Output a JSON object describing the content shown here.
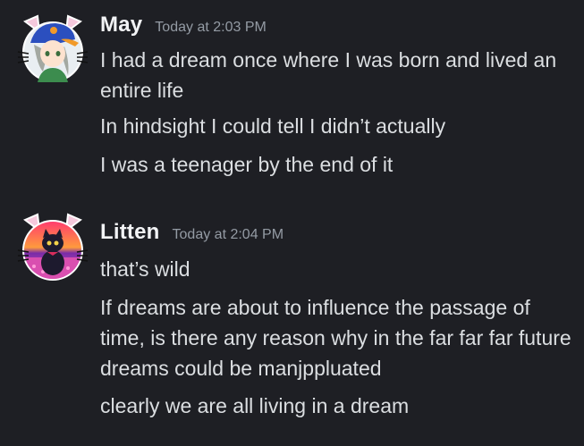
{
  "messages": [
    {
      "username": "May",
      "timestamp": "Today at 2:03 PM",
      "avatar_icon": "anime-character-with-cat-ears-avatar",
      "name_color": "#f2f3f5",
      "lines": [
        "I had a dream once where I was born and lived an entire life",
        "In hindsight I could tell I didn’t actually",
        "I was a teenager by the end of it"
      ]
    },
    {
      "username": "Litten",
      "timestamp": "Today at 2:04 PM",
      "avatar_icon": "black-cat-sunset-avatar",
      "name_color": "#f2f3f5",
      "lines": [
        "that’s wild",
        "If dreams are about to influence the passage of time, is there any reason why in the far far far future dreams could be manjppluated",
        "clearly we are all living in a dream"
      ]
    }
  ],
  "colors": {
    "background": "#1e1f24",
    "text": "#dbdee1",
    "timestamp": "#949ba4",
    "username": "#f2f3f5"
  }
}
